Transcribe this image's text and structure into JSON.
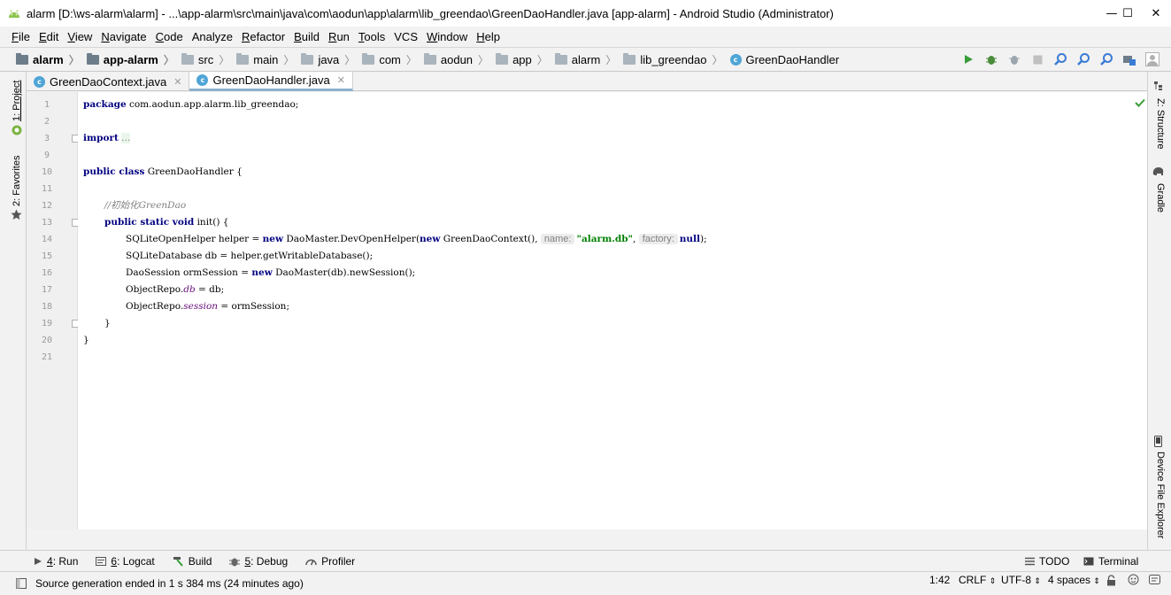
{
  "window": {
    "title": "alarm [D:\\ws-alarm\\alarm] - ...\\app-alarm\\src\\main\\java\\com\\aodun\\app\\alarm\\lib_greendao\\GreenDaoHandler.java [app-alarm] - Android Studio (Administrator)",
    "minimize": "—",
    "maximize": "☐",
    "close": "✕"
  },
  "menu": {
    "items": [
      {
        "u": "F",
        "rest": "ile"
      },
      {
        "u": "E",
        "rest": "dit"
      },
      {
        "u": "V",
        "rest": "iew"
      },
      {
        "u": "N",
        "rest": "avigate"
      },
      {
        "u": "C",
        "rest": "ode"
      },
      {
        "u": "",
        "rest": "Analyze"
      },
      {
        "u": "R",
        "rest": "efactor"
      },
      {
        "u": "B",
        "rest": "uild"
      },
      {
        "u": "R",
        "rest": "un"
      },
      {
        "u": "T",
        "rest": "ools"
      },
      {
        "u": "",
        "rest": "VCS"
      },
      {
        "u": "W",
        "rest": "indow"
      },
      {
        "u": "H",
        "rest": "elp"
      }
    ]
  },
  "breadcrumbs": [
    "alarm",
    "app-alarm",
    "src",
    "main",
    "java",
    "com",
    "aodun",
    "app",
    "alarm",
    "lib_greendao",
    "GreenDaoHandler"
  ],
  "tabs": [
    {
      "label": "GreenDaoContext.java",
      "close": "✕"
    },
    {
      "label": "GreenDaoHandler.java",
      "close": "✕"
    }
  ],
  "left_tool_tabs": [
    "1: Project",
    "2: Favorites"
  ],
  "right_tool_tabs": [
    "Z: Structure",
    "Gradle",
    "Device File Explorer"
  ],
  "code": {
    "line_numbers": [
      "1",
      "2",
      "3",
      "9",
      "10",
      "11",
      "12",
      "13",
      "14",
      "15",
      "16",
      "17",
      "18",
      "19",
      "20",
      "21"
    ],
    "package_kw": "package",
    "package_name": " com.aodun.app.alarm.lib_greendao;",
    "import_kw": "import",
    "import_collapsed": "...",
    "class_decl_kw": "public class",
    "class_decl_rest": " GreenDaoHandler {",
    "comment": "//初始化GreenDao",
    "init_kw": "public static void",
    "init_rest": " init() {",
    "l14_a": "SQLiteOpenHelper helper = ",
    "l14_new1": "new",
    "l14_b": " DaoMaster.DevOpenHelper(",
    "l14_new2": "new",
    "l14_c": " GreenDaoContext(), ",
    "hint_name": "name:",
    "l14_str": "\"alarm.db\"",
    "l14_d": ", ",
    "hint_factory": "factory:",
    "l14_null": "null",
    "l14_e": ");",
    "l15": "SQLiteDatabase db = helper.getWritableDatabase();",
    "l16_a": "DaoSession ormSession = ",
    "l16_new": "new",
    "l16_b": " DaoMaster(db).newSession();",
    "l17_a": "ObjectRepo.",
    "l17_fld": "db",
    "l17_b": " = db;",
    "l18_a": "ObjectRepo.",
    "l18_fld": "session",
    "l18_b": " = ormSession;",
    "l19": "}",
    "l20": "}"
  },
  "bottom_tools": [
    {
      "num": "4",
      "label": ": Run"
    },
    {
      "num": "6",
      "label": ": Logcat"
    },
    {
      "num": "",
      "label": "Build"
    },
    {
      "num": "5",
      "label": ": Debug"
    },
    {
      "num": "",
      "label": "Profiler"
    }
  ],
  "bottom_right_tools": [
    "TODO",
    "Terminal"
  ],
  "status": {
    "message": "Source generation ended in 1 s 384 ms (24 minutes ago)",
    "position": "1:42",
    "line_sep": "CRLF",
    "encoding": "UTF-8",
    "indent": "4 spaces"
  },
  "colors": {
    "keyword": "#000080",
    "string": "#008000",
    "field": "#660e7a",
    "comment": "#808080",
    "run_green": "#3a9c3a",
    "search_blue": "#3a7bd5"
  }
}
